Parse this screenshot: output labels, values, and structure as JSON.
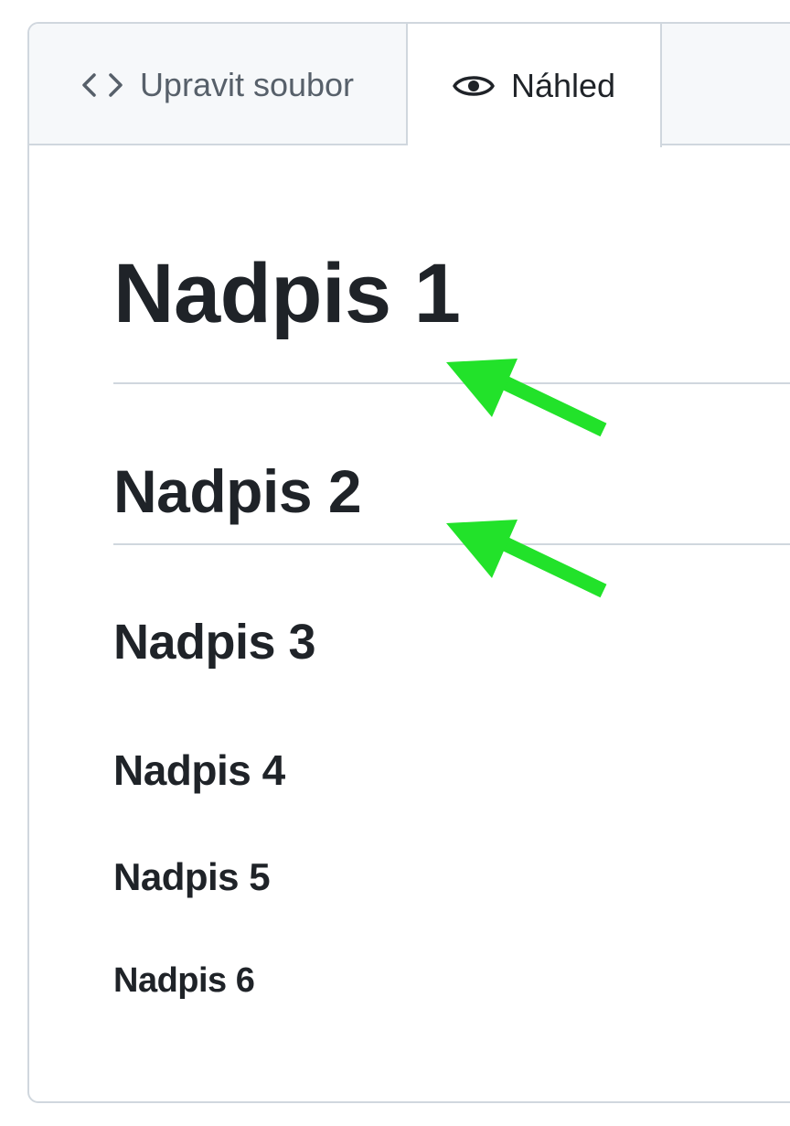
{
  "tabs": {
    "edit_label": "Upravit soubor",
    "preview_label": "Náhled"
  },
  "headings": {
    "h1": "Nadpis 1",
    "h2": "Nadpis 2",
    "h3": "Nadpis 3",
    "h4": "Nadpis 4",
    "h5": "Nadpis 5",
    "h6": "Nadpis 6"
  },
  "annotation": {
    "arrow_color": "#22e22a"
  },
  "colors": {
    "text": "#1f2328",
    "muted_text": "#57606a",
    "border": "#d0d7de",
    "tab_bg": "#f6f8fa"
  },
  "icons": {
    "edit_tab_icon": "code-icon",
    "preview_tab_icon": "eye-icon"
  }
}
